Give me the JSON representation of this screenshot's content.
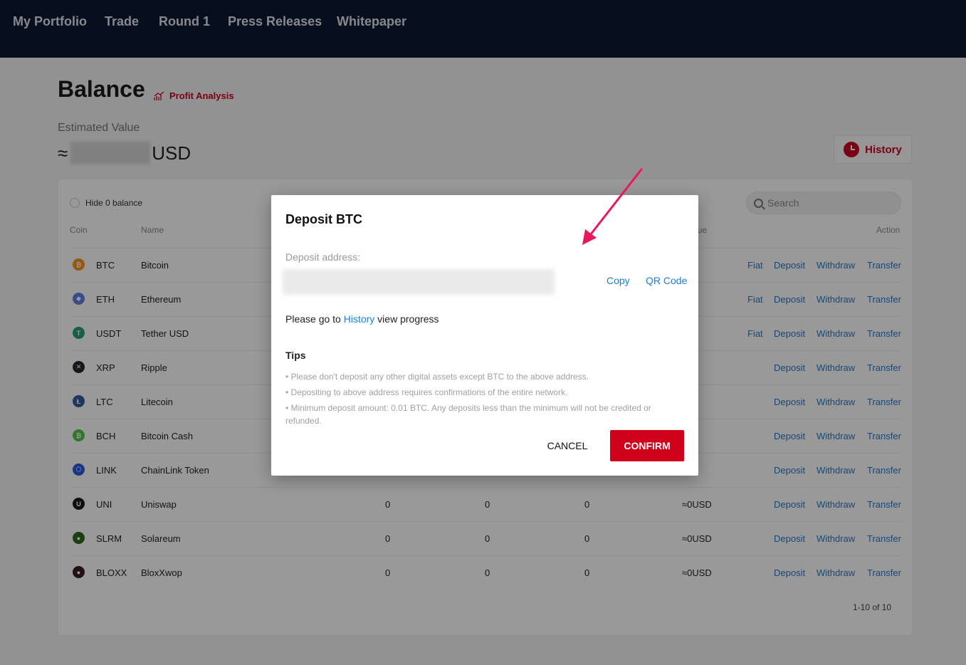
{
  "nav": {
    "items": [
      "My Portfolio",
      "Trade",
      "Round 1",
      "Press Releases",
      "Whitepaper"
    ]
  },
  "balance": {
    "title": "Balance",
    "profit_analysis": "Profit Analysis",
    "estimated_label": "Estimated Value",
    "approx_symbol": "≈",
    "currency": "USD",
    "history_label": "History"
  },
  "table": {
    "hide_zero_label": "Hide 0 balance",
    "search_placeholder": "Search",
    "headers": {
      "coin": "Coin",
      "name": "Name",
      "value_partial": "lue",
      "action": "Action"
    },
    "rows": [
      {
        "coin": "BTC",
        "name": "Bitcoin",
        "a": "",
        "b": "",
        "c": "",
        "value": "SD",
        "fiat": "Fiat",
        "icon_color": "#f7931a",
        "icon": "btc-icon",
        "glyph": "₿"
      },
      {
        "coin": "ETH",
        "name": "Ethereum",
        "a": "",
        "b": "",
        "c": "",
        "value": "SD",
        "fiat": "Fiat",
        "icon_color": "#627eea",
        "icon": "eth-icon",
        "glyph": "◆"
      },
      {
        "coin": "USDT",
        "name": "Tether USD",
        "a": "",
        "b": "",
        "c": "",
        "value": "SD",
        "fiat": "Fiat",
        "icon_color": "#26a17b",
        "icon": "usdt-icon",
        "glyph": "T"
      },
      {
        "coin": "XRP",
        "name": "Ripple",
        "a": "",
        "b": "",
        "c": "",
        "value": "SD",
        "fiat": "",
        "icon_color": "#23292f",
        "icon": "xrp-icon",
        "glyph": "✕"
      },
      {
        "coin": "LTC",
        "name": "Litecoin",
        "a": "",
        "b": "",
        "c": "",
        "value": "SD",
        "fiat": "",
        "icon_color": "#345d9d",
        "icon": "ltc-icon",
        "glyph": "Ł"
      },
      {
        "coin": "BCH",
        "name": "Bitcoin Cash",
        "a": "",
        "b": "",
        "c": "",
        "value": "SD",
        "fiat": "",
        "icon_color": "#4cc947",
        "icon": "bch-icon",
        "glyph": "₿"
      },
      {
        "coin": "LINK",
        "name": "ChainLink Token",
        "a": "",
        "b": "",
        "c": "",
        "value": "SD",
        "fiat": "",
        "icon_color": "#2a5ada",
        "icon": "link-icon",
        "glyph": "⬡"
      },
      {
        "coin": "UNI",
        "name": "Uniswap",
        "a": "0",
        "b": "0",
        "c": "0",
        "value": "≈0USD",
        "fiat": "",
        "icon_color": "#1a1a1a",
        "icon": "uni-icon",
        "glyph": "U"
      },
      {
        "coin": "SLRM",
        "name": "Solareum",
        "a": "0",
        "b": "0",
        "c": "0",
        "value": "≈0USD",
        "fiat": "",
        "icon_color": "#2d6a1f",
        "icon": "slrm-icon",
        "glyph": "●"
      },
      {
        "coin": "BLOXX",
        "name": "BloxXwop",
        "a": "0",
        "b": "0",
        "c": "0",
        "value": "≈0USD",
        "fiat": "",
        "icon_color": "#3a1d1d",
        "icon": "bloxx-icon",
        "glyph": "●"
      }
    ],
    "actions": {
      "deposit": "Deposit",
      "withdraw": "Withdraw",
      "transfer": "Transfer"
    },
    "pager": "1-10 of 10"
  },
  "modal": {
    "title": "Deposit BTC",
    "address_label": "Deposit address:",
    "copy": "Copy",
    "qr_code": "QR Code",
    "progress_prefix": "Please go to ",
    "progress_link": "History",
    "progress_suffix": " view progress",
    "tips_title": "Tips",
    "tips": [
      "• Please don't deposit any other digital assets except BTC to the above address.",
      "• Depositing to above address requires confirmations of the entire network.",
      "• Minimum deposit amount: 0.01 BTC. Any deposits less than the minimum will not be credited or refunded."
    ],
    "cancel": "CANCEL",
    "confirm": "CONFIRM"
  },
  "colors": {
    "nav_bg": "#0d1a33",
    "accent_red": "#d0021b",
    "link_blue": "#1a7fd6",
    "annotation_arrow": "#e8195a"
  }
}
